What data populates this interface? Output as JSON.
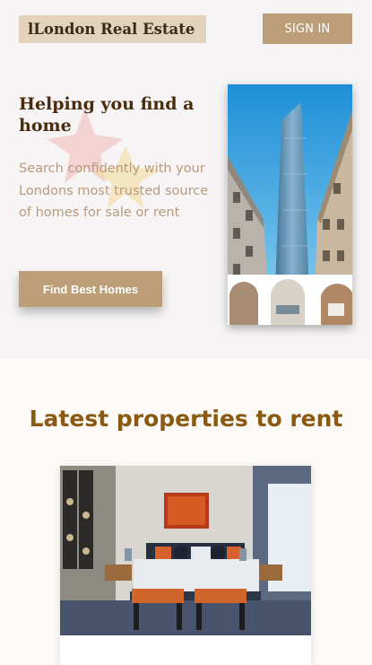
{
  "header": {
    "logo_text": "lLondon Real Estate",
    "signin_label": "SIGN IN"
  },
  "hero": {
    "headline": "Helping you find a home",
    "subtext": "Search confidently with your Londons most trusted source of homes for sale or rent",
    "cta_label": "Find Best Homes"
  },
  "latest": {
    "title": "Latest properties to rent"
  },
  "colors": {
    "brand": "#bc9e78",
    "logo_bg": "#e3d3bd",
    "headline": "#4a2c0d",
    "section_title": "#8a5a12"
  }
}
